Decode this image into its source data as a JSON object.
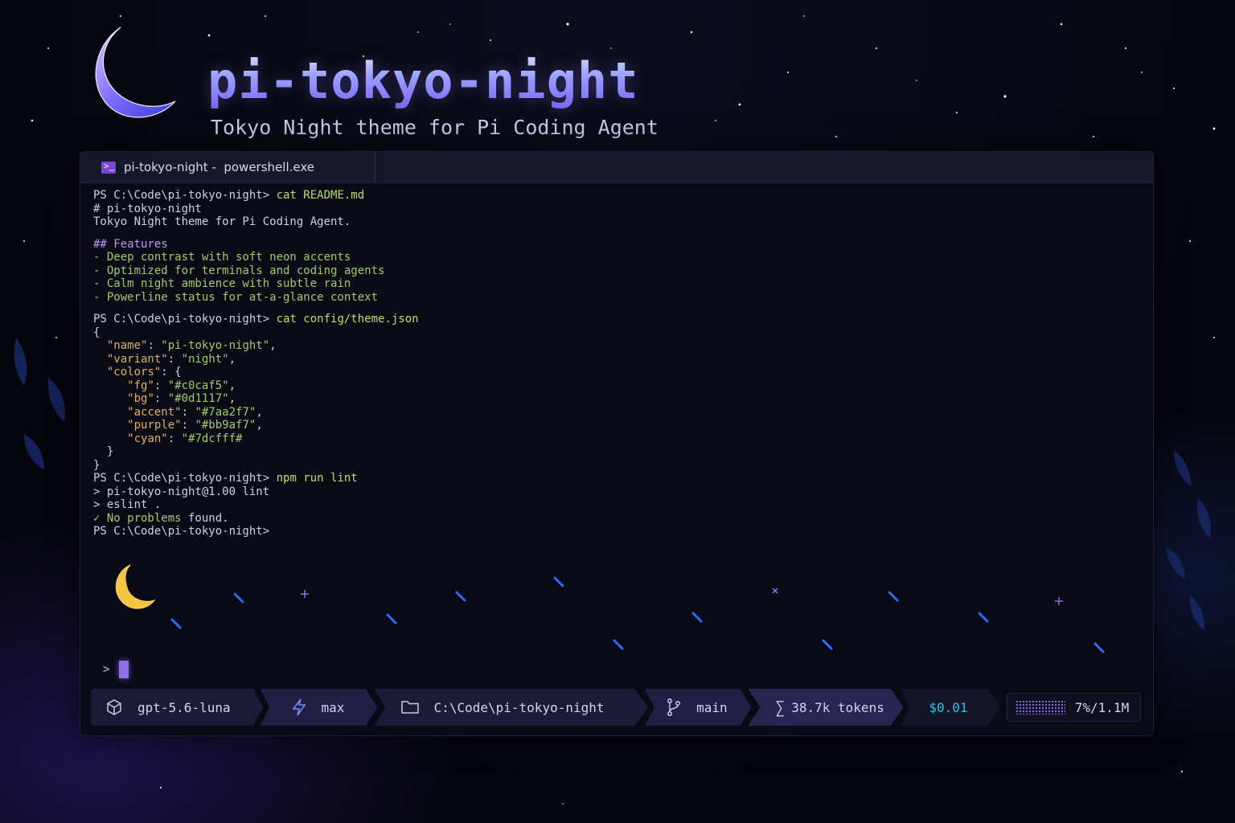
{
  "hero": {
    "title": "pi-tokyo-night",
    "subtitle": "Tokyo Night theme for Pi Coding Agent"
  },
  "window": {
    "tab_label": "pi-tokyo-night -  powershell.exe",
    "tab_icon": "powershell-icon"
  },
  "terminal": {
    "prompt": "PS C:\\Code\\pi-tokyo-night>",
    "cmd1": "cat README.md",
    "readme_title": "# pi-tokyo-night",
    "readme_desc": "Tokyo Night theme for Pi Coding Agent.",
    "features_heading": "## Features",
    "features": [
      "- Deep contrast with soft neon accents",
      "- Optimized for terminals and coding agents",
      "- Calm night ambience with subtle rain",
      "- Powerline status for at-a-glance context"
    ],
    "cmd2": "cat config/theme.json",
    "json_open": "{",
    "json_name_key": "\"name\"",
    "json_name_val": "\"pi-tokyo-night\"",
    "json_variant_key": "\"variant\"",
    "json_variant_val": "\"night\"",
    "json_colors_key": "\"colors\"",
    "colors": [
      {
        "key": "\"fg\"",
        "val": "\"#c0caf5\""
      },
      {
        "key": "\"bg\"",
        "val": "\"#0d1117\""
      },
      {
        "key": "\"accent\"",
        "val": "\"#7aa2f7\""
      },
      {
        "key": "\"purple\"",
        "val": "\"#bb9af7\""
      },
      {
        "key": "\"cyan\"",
        "val": "\"#7dcfff#"
      }
    ],
    "json_inner_close": "}",
    "json_close": "}",
    "cmd3": "npm run lint",
    "lint_line1": "> pi-tokyo-night@1.00 lint",
    "lint_line2": "> eslint .",
    "check_mark": "✓ No problems",
    "check_rest": " found.",
    "input_caret": ">"
  },
  "status": {
    "model": "gpt-5.6-luna",
    "model_icon": "cube-icon",
    "effort": "max",
    "effort_icon": "lightning-icon",
    "path": "C:\\Code\\pi-tokyo-night",
    "path_icon": "folder-icon",
    "branch": "main",
    "branch_icon": "git-branch-icon",
    "tokens": "38.7k tokens",
    "tokens_icon": "sigma-icon",
    "cost": "$0.01",
    "context": "7%/1.1M"
  },
  "colors": {
    "background": "#05060d",
    "terminal_bg": "#090a16",
    "accent_purple": "#bb9af7",
    "accent_green": "#9ece6a",
    "accent_cyan": "#2ac3de",
    "rain_blue": "#2f6bff",
    "moon_yellow": "#f5c542"
  }
}
